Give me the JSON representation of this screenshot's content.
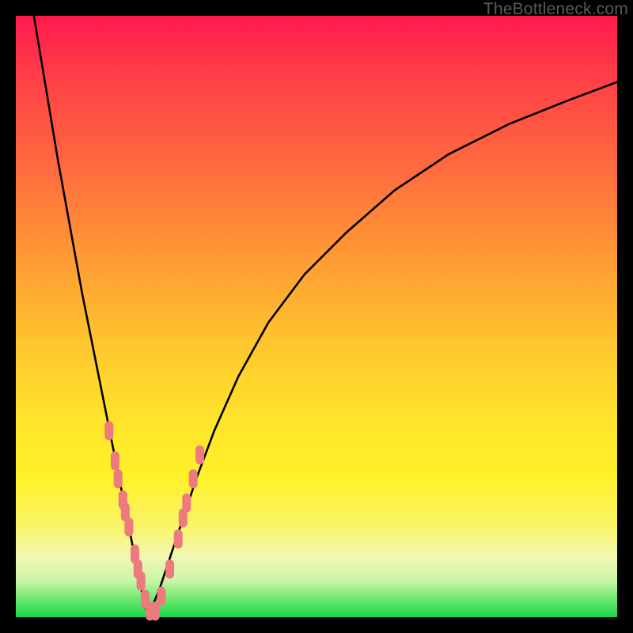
{
  "watermark": "TheBottleneck.com",
  "colors": {
    "background_frame": "#000000",
    "curve_stroke": "#000000",
    "marker_fill": "#ed7a7d",
    "gradient_stops": [
      "#ff1a4d",
      "#ff6a3e",
      "#ffc72e",
      "#fff12a",
      "#f2f8b4",
      "#18d84a"
    ]
  },
  "chart_data": {
    "type": "line",
    "title": "",
    "xlabel": "",
    "ylabel": "",
    "xlim": [
      0,
      100
    ],
    "ylim": [
      0,
      100
    ],
    "grid": false,
    "legend": false,
    "note": "Axes unlabeled; values estimated from pixel positions. Two curves share a minimum near x≈22, y≈0. Left branch rises steeply to top-left corner; right branch rises toward top-right with decreasing slope.",
    "series": [
      {
        "name": "left_branch",
        "x": [
          3,
          5,
          7,
          9,
          11,
          13,
          14,
          15,
          16,
          17,
          18,
          19,
          20,
          21,
          22
        ],
        "y": [
          100,
          88,
          76,
          65,
          54,
          44,
          39,
          34,
          29,
          24,
          19,
          14,
          9,
          4,
          0
        ]
      },
      {
        "name": "right_branch",
        "x": [
          22,
          24,
          26,
          28,
          30,
          33,
          37,
          42,
          48,
          55,
          63,
          72,
          82,
          92,
          100
        ],
        "y": [
          0,
          5,
          11,
          17,
          23,
          31,
          40,
          49,
          57,
          64,
          71,
          77,
          82,
          86,
          89
        ]
      }
    ],
    "markers": {
      "note": "Salmon lozenge markers clustered near the valley on both branches.",
      "points": [
        {
          "x": 15.5,
          "y": 31
        },
        {
          "x": 16.5,
          "y": 26
        },
        {
          "x": 17,
          "y": 23
        },
        {
          "x": 17.8,
          "y": 19.5
        },
        {
          "x": 18.2,
          "y": 17.5
        },
        {
          "x": 18.8,
          "y": 15
        },
        {
          "x": 19.8,
          "y": 10.5
        },
        {
          "x": 20.3,
          "y": 8
        },
        {
          "x": 20.8,
          "y": 6
        },
        {
          "x": 21.5,
          "y": 3
        },
        {
          "x": 22.3,
          "y": 1
        },
        {
          "x": 23.2,
          "y": 1
        },
        {
          "x": 24.2,
          "y": 3.5
        },
        {
          "x": 25.6,
          "y": 8
        },
        {
          "x": 27,
          "y": 13
        },
        {
          "x": 27.8,
          "y": 16.5
        },
        {
          "x": 28.4,
          "y": 19
        },
        {
          "x": 29.5,
          "y": 23
        },
        {
          "x": 30.6,
          "y": 27
        }
      ]
    }
  }
}
